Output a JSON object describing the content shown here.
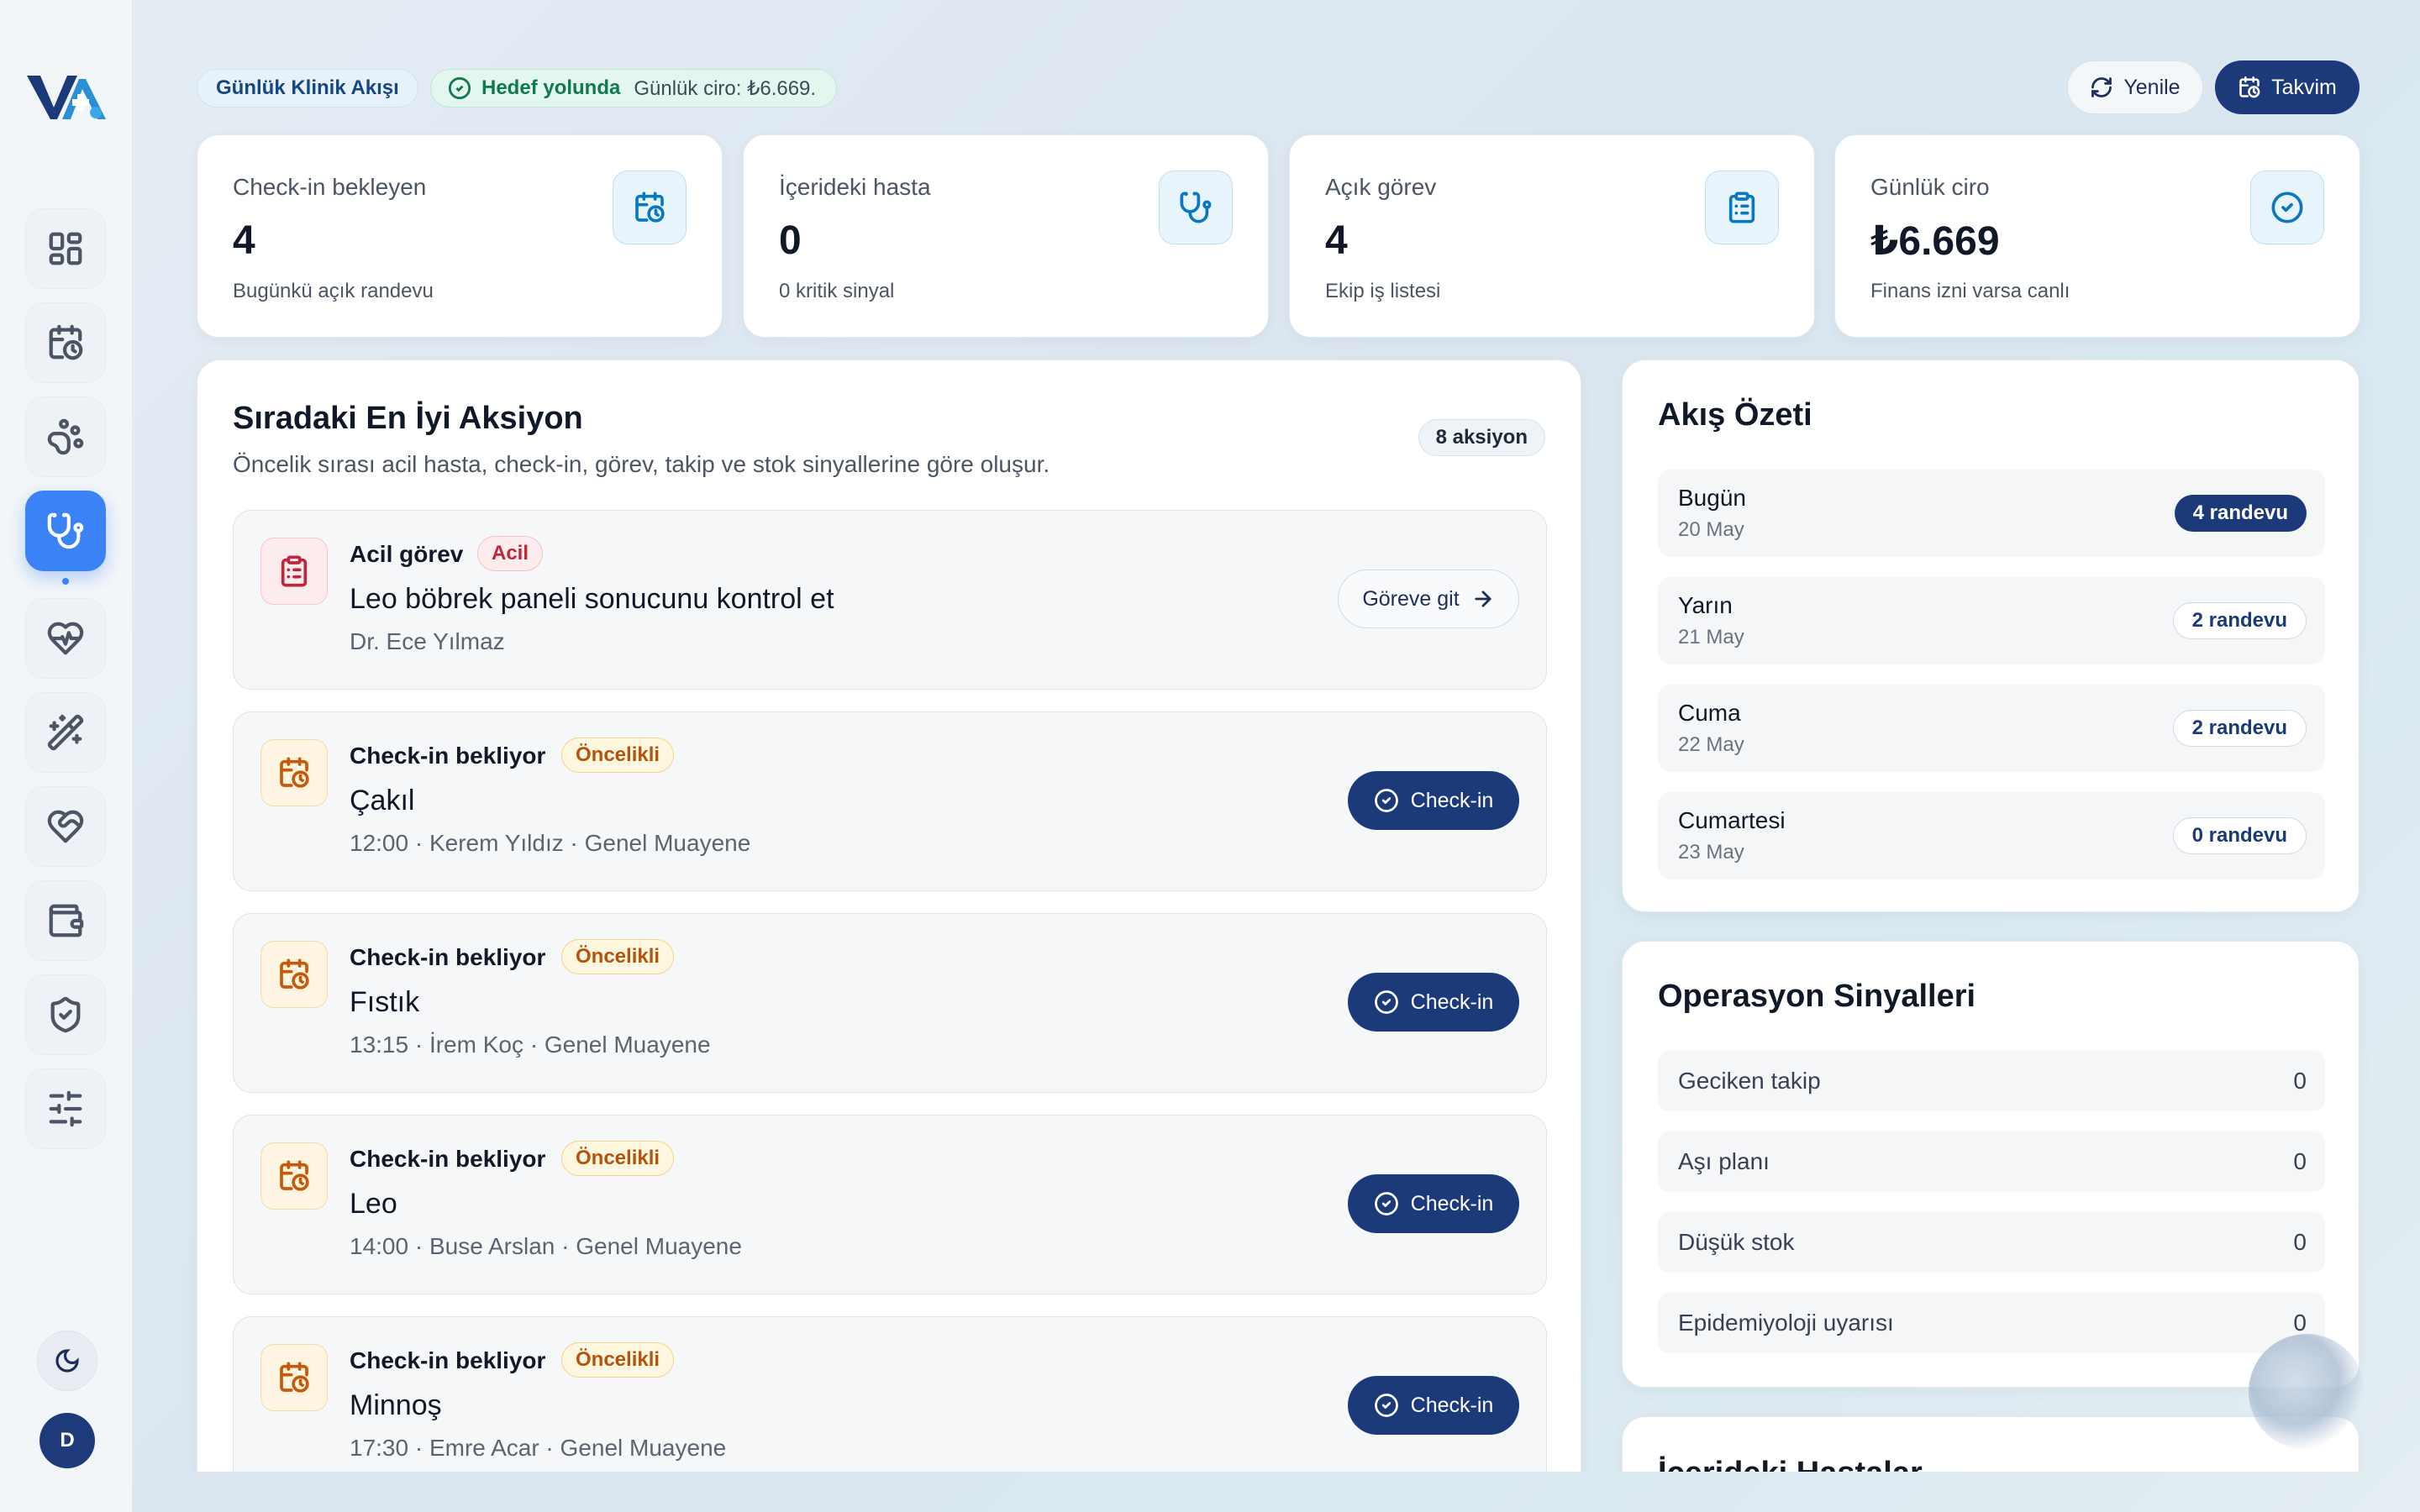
{
  "sidebar": {
    "logo": "vet-clinic-logo",
    "nav": [
      {
        "icon": "dashboard-icon"
      },
      {
        "icon": "calendar-clock-icon"
      },
      {
        "icon": "paw-icon"
      },
      {
        "icon": "stethoscope-icon",
        "active": true
      },
      {
        "icon": "heart-pulse-icon"
      },
      {
        "icon": "magic-wand-icon"
      },
      {
        "icon": "heart-handshake-icon"
      },
      {
        "icon": "wallet-icon"
      },
      {
        "icon": "shield-check-icon"
      },
      {
        "icon": "sliders-icon"
      }
    ],
    "theme_icon": "moon-icon",
    "avatar_initial": "D"
  },
  "topbar": {
    "flow_chip": "Günlük Klinik Akışı",
    "goal_status": "Hedef yolunda",
    "goal_detail": "Günlük ciro: ₺6.669.",
    "refresh_label": "Yenile",
    "calendar_label": "Takvim"
  },
  "stats": [
    {
      "label": "Check-in bekleyen",
      "value": "4",
      "sub": "Bugünkü açık randevu",
      "icon": "calendar-clock-icon"
    },
    {
      "label": "İçerideki hasta",
      "value": "0",
      "sub": "0 kritik sinyal",
      "icon": "stethoscope-icon"
    },
    {
      "label": "Açık görev",
      "value": "4",
      "sub": "Ekip iş listesi",
      "icon": "clipboard-list-icon"
    },
    {
      "label": "Günlük ciro",
      "value": "₺6.669",
      "sub": "Finans izni varsa canlı",
      "icon": "check-circle-icon"
    }
  ],
  "next_action": {
    "title": "Sıradaki En İyi Aksiyon",
    "description": "Öncelik sırası acil hasta, check-in, görev, takip ve stok sinyallerine göre oluşur.",
    "count_badge": "8 aksiyon",
    "items": [
      {
        "type": "Acil görev",
        "tag": "Acil",
        "title": "Leo böbrek paneli sonucunu kontrol et",
        "sub": "Dr. Ece Yılmaz",
        "button": "Göreve git"
      },
      {
        "type": "Check-in bekliyor",
        "tag": "Öncelikli",
        "title": "Çakıl",
        "sub": "12:00 · Kerem Yıldız · Genel Muayene",
        "button": "Check-in"
      },
      {
        "type": "Check-in bekliyor",
        "tag": "Öncelikli",
        "title": "Fıstık",
        "sub": "13:15 · İrem Koç · Genel Muayene",
        "button": "Check-in"
      },
      {
        "type": "Check-in bekliyor",
        "tag": "Öncelikli",
        "title": "Leo",
        "sub": "14:00 · Buse Arslan · Genel Muayene",
        "button": "Check-in"
      },
      {
        "type": "Check-in bekliyor",
        "tag": "Öncelikli",
        "title": "Minnoş",
        "sub": "17:30 · Emre Acar · Genel Muayene",
        "button": "Check-in"
      }
    ]
  },
  "flow_summary": {
    "title": "Akış Özeti",
    "rows": [
      {
        "day": "Bugün",
        "date": "20 May",
        "count": "4 randevu"
      },
      {
        "day": "Yarın",
        "date": "21 May",
        "count": "2 randevu"
      },
      {
        "day": "Cuma",
        "date": "22 May",
        "count": "2 randevu"
      },
      {
        "day": "Cumartesi",
        "date": "23 May",
        "count": "0 randevu"
      }
    ]
  },
  "ops_signals": {
    "title": "Operasyon Sinyalleri",
    "rows": [
      {
        "label": "Geciken takip",
        "value": "0"
      },
      {
        "label": "Aşı planı",
        "value": "0"
      },
      {
        "label": "Düşük stok",
        "value": "0"
      },
      {
        "label": "Epidemiyoloji uyarısı",
        "value": "0"
      }
    ]
  },
  "inside_patients": {
    "title": "İçerideki Hastalar"
  },
  "colors": {
    "primary": "#1c3a7a",
    "accent": "#3b82f6",
    "urgent": "#c0263b",
    "priority": "#b5530a",
    "success": "#0f7a4d"
  }
}
